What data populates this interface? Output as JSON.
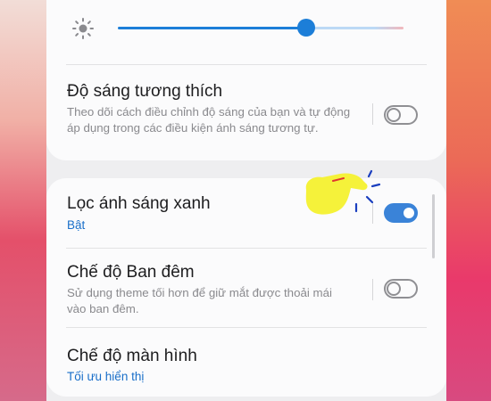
{
  "brightness": {
    "level_percent": 66,
    "icon": "sun-icon"
  },
  "adaptive_brightness": {
    "title": "Độ sáng tương thích",
    "description": "Theo dõi cách điều chỉnh độ sáng của bạn và tự động áp dụng trong các điều kiện ánh sáng tương tự.",
    "enabled": false
  },
  "blue_light_filter": {
    "title": "Lọc ánh sáng xanh",
    "status": "Bật",
    "enabled": true
  },
  "night_mode": {
    "title": "Chế độ Ban đêm",
    "description": "Sử dụng theme tối hơn để giữ mắt được thoải mái vào ban đêm.",
    "enabled": false
  },
  "screen_mode": {
    "title": "Chế độ màn hình",
    "value": "Tối ưu hiển thị"
  },
  "colors": {
    "accent": "#1c7ed8",
    "toggle_on": "#3a83d8",
    "hand": "#f5f23a"
  }
}
